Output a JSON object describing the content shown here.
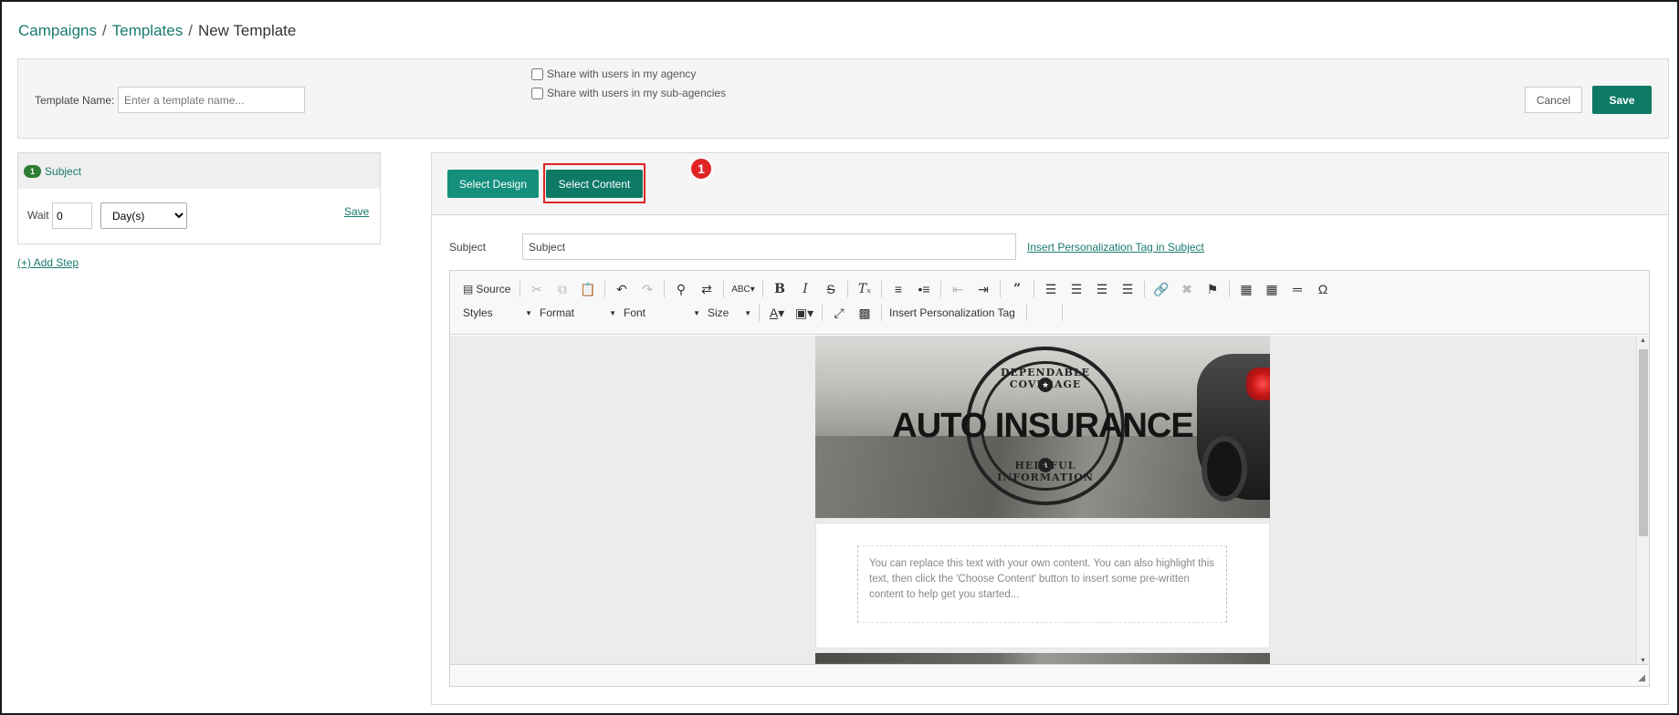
{
  "breadcrumb": {
    "items": [
      "Campaigns",
      "Templates"
    ],
    "separator": "/",
    "current": "New Template"
  },
  "header": {
    "template_name_label": "Template Name:",
    "template_name_placeholder": "Enter a template name...",
    "share_agency": "Share with users in my agency",
    "share_subagencies": "Share with users in my sub-agencies",
    "cancel": "Cancel",
    "save": "Save"
  },
  "steps": {
    "items": [
      {
        "number": "1",
        "title": "Subject"
      }
    ],
    "wait_label": "Wait",
    "wait_value": "0",
    "wait_unit": "Day(s)",
    "save": "Save",
    "add_step": "(+) Add Step"
  },
  "content": {
    "select_design": "Select Design",
    "select_content": "Select Content",
    "annotation_marker": "1",
    "subject_label": "Subject",
    "subject_value": "Subject",
    "insert_tag_subject": "Insert Personalization Tag in Subject"
  },
  "editor": {
    "toolbar": {
      "source": "Source",
      "styles": "Styles",
      "format": "Format",
      "font": "Font",
      "size": "Size",
      "insert_tag": "Insert Personalization Tag"
    },
    "hero": {
      "title": "AUTO INSURANCE",
      "seal_top": "DEPENDABLE COVERAGE",
      "seal_bottom": "HELPFUL INFORMATION"
    },
    "placeholder_text": "You can replace this text with your own content. You can also highlight this text, then click the 'Choose Content' button to insert some pre-written content to help get you started..."
  },
  "colors": {
    "brand": "#0e7a66",
    "link": "#1a7a6c",
    "annotation": "#e02424",
    "badge": "#2e7d32"
  }
}
